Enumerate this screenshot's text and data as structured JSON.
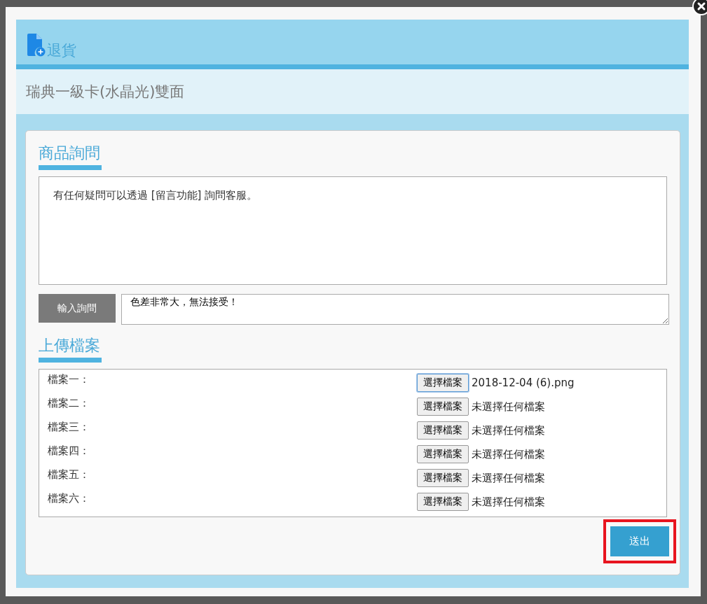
{
  "dialog": {
    "title": "退貨",
    "product": "瑞典一級卡(水晶光)雙面"
  },
  "inquiry": {
    "heading": "商品詢問",
    "message": "有任何疑問可以透過 [留言功能] 詢問客服。",
    "input_label": "輸入詢問",
    "input_value": "色差非常大，無法接受！"
  },
  "upload": {
    "heading": "上傳檔案",
    "files": [
      {
        "label": "檔案一：",
        "button": "選擇檔案",
        "status": "2018-12-04 (6).png",
        "focused": true
      },
      {
        "label": "檔案二：",
        "button": "選擇檔案",
        "status": "未選擇任何檔案",
        "focused": false
      },
      {
        "label": "檔案三：",
        "button": "選擇檔案",
        "status": "未選擇任何檔案",
        "focused": false
      },
      {
        "label": "檔案四：",
        "button": "選擇檔案",
        "status": "未選擇任何檔案",
        "focused": false
      },
      {
        "label": "檔案五：",
        "button": "選擇檔案",
        "status": "未選擇任何檔案",
        "focused": false
      },
      {
        "label": "檔案六：",
        "button": "選擇檔案",
        "status": "未選擇任何檔案",
        "focused": false
      }
    ]
  },
  "submit": {
    "label": "送出",
    "highlighted": true
  }
}
